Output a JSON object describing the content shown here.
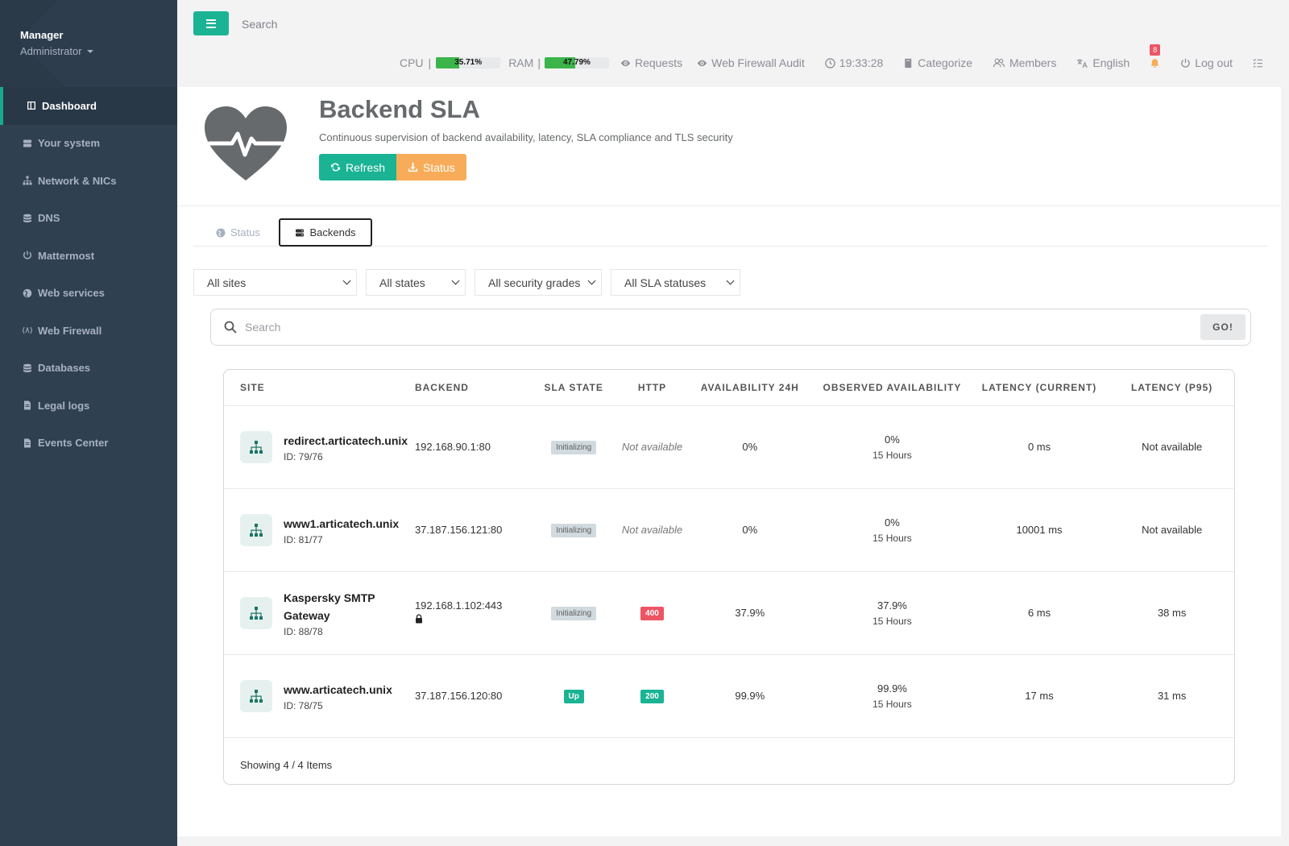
{
  "sidebar": {
    "user_name": "Manager",
    "user_role": "Administrator",
    "items": [
      {
        "label": "Dashboard",
        "icon": "dashboard-icon"
      },
      {
        "label": "Your system",
        "icon": "server-icon"
      },
      {
        "label": "Network & NICs",
        "icon": "network-icon"
      },
      {
        "label": "DNS",
        "icon": "database-icon"
      },
      {
        "label": "Mattermost",
        "icon": "power-icon"
      },
      {
        "label": "Web services",
        "icon": "globe-icon"
      },
      {
        "label": "Web Firewall",
        "icon": "firewall-icon"
      },
      {
        "label": "Databases",
        "icon": "database-icon"
      },
      {
        "label": "Legal logs",
        "icon": "file-icon"
      },
      {
        "label": "Events Center",
        "icon": "file-icon"
      }
    ]
  },
  "topbar": {
    "search_placeholder": "Search",
    "cpu_label": "CPU",
    "cpu_percent": "35.71%",
    "cpu_value": 35.71,
    "ram_label": "RAM",
    "ram_percent": "47.79%",
    "ram_value": 47.79,
    "separator": "|",
    "requests": "Requests",
    "waf_audit": "Web Firewall Audit",
    "clock": "19:33:28",
    "categorize": "Categorize",
    "members": "Members",
    "language": "English",
    "notifications": "8",
    "logout": "Log out"
  },
  "header": {
    "title": "Backend SLA",
    "subtitle": "Continuous supervision of backend availability, latency, SLA compliance and TLS security",
    "refresh_label": "Refresh",
    "status_label": "Status"
  },
  "tabs": [
    {
      "label": "Status"
    },
    {
      "label": "Backends"
    }
  ],
  "filters": {
    "sites": "All sites",
    "states": "All states",
    "grades": "All security grades",
    "sla": "All SLA statuses"
  },
  "search": {
    "placeholder": "Search",
    "go_label": "GO!"
  },
  "table": {
    "columns": [
      "SITE",
      "BACKEND",
      "SLA STATE",
      "HTTP",
      "AVAILABILITY 24H",
      "OBSERVED AVAILABILITY",
      "LATENCY (CURRENT)",
      "LATENCY (P95)"
    ],
    "rows": [
      {
        "site": "redirect.articatech.unix",
        "id": "ID: 79/76",
        "backend": "192.168.90.1:80",
        "sla": "Initializing",
        "http": "Not available",
        "avail24": "0%",
        "observed": "0%",
        "observed_sub": "15 Hours",
        "lat_cur": "0 ms",
        "lat_p95": "Not available"
      },
      {
        "site": "www1.articatech.unix",
        "id": "ID: 81/77",
        "backend": "37.187.156.121:80",
        "sla": "Initializing",
        "http": "Not available",
        "avail24": "0%",
        "observed": "0%",
        "observed_sub": "15 Hours",
        "lat_cur": "10001 ms",
        "lat_p95": "Not available"
      },
      {
        "site": "Kaspersky SMTP Gateway",
        "id": "ID: 88/78",
        "backend": "192.168.1.102:443",
        "sla": "Initializing",
        "http": "400",
        "avail24": "37.9%",
        "observed": "37.9%",
        "observed_sub": "15 Hours",
        "lat_cur": "6 ms",
        "lat_p95": "38 ms"
      },
      {
        "site": "www.articatech.unix",
        "id": "ID: 78/75",
        "backend": "37.187.156.120:80",
        "sla": "Up",
        "http": "200",
        "avail24": "99.9%",
        "observed": "99.9%",
        "observed_sub": "15 Hours",
        "lat_cur": "17 ms",
        "lat_p95": "31 ms"
      }
    ],
    "footer": "Showing 4 / 4 Items"
  },
  "colors": {
    "accent": "#1ab394",
    "warning": "#f8ac59",
    "danger": "#ed5565",
    "sidebar": "#2f4050"
  }
}
